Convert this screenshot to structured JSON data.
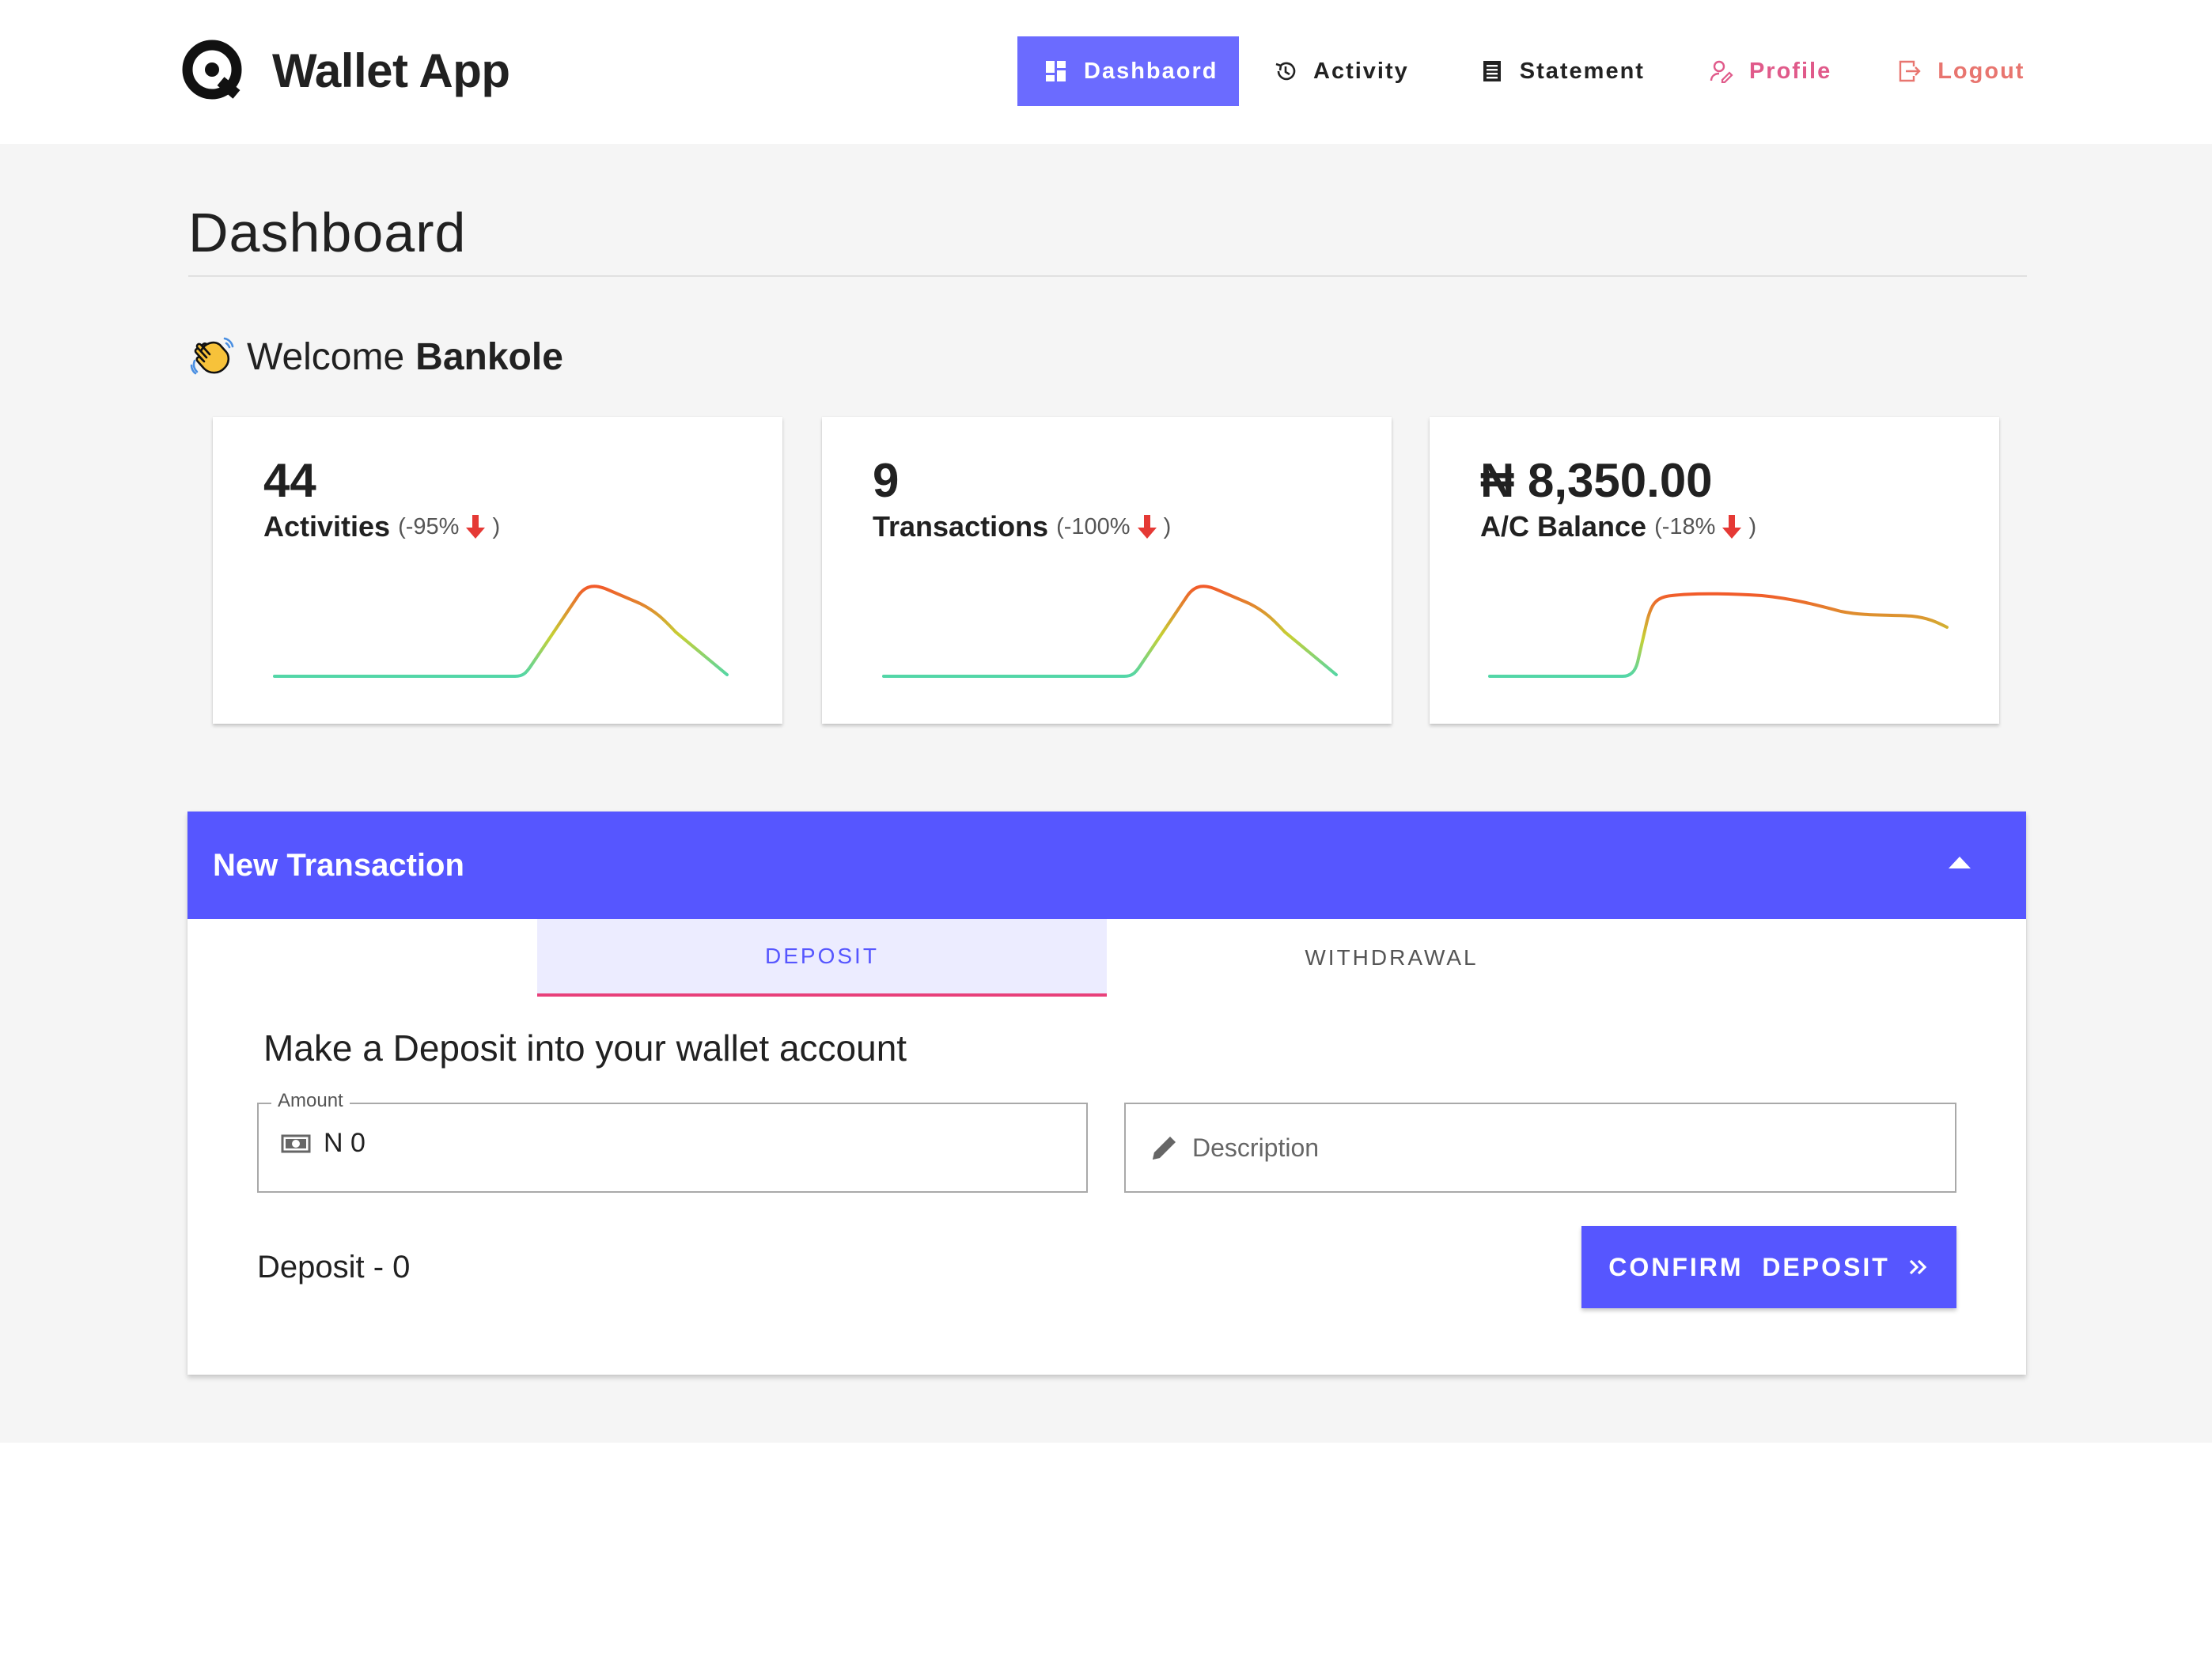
{
  "header": {
    "app_title": "Wallet App",
    "logo_icon": "q-logo-icon",
    "nav": {
      "dashboard": "Dashbaord",
      "activity": "Activity",
      "statement": "Statement",
      "profile": "Profile",
      "logout": "Logout"
    },
    "active_item": "dashboard",
    "colors": {
      "active_bg": "#6b6bff",
      "profile": "#e05a8a",
      "logout": "#e8756f"
    }
  },
  "page": {
    "title": "Dashboard",
    "welcome_prefix": "Welcome",
    "user_name": "Bankole",
    "welcome_icon": "waving-hand-icon"
  },
  "cards": [
    {
      "value": "44",
      "label": "Activities",
      "change_open": "(-95%",
      "change_close": ")",
      "trend_icon": "arrow-down-icon"
    },
    {
      "value": "9",
      "label": "Transactions",
      "change_open": "(-100%",
      "change_close": ")",
      "trend_icon": "arrow-down-icon"
    },
    {
      "value": "₦ 8,350.00",
      "label": "A/C Balance",
      "change_open": "(-18%",
      "change_close": ")",
      "trend_icon": "arrow-down-icon"
    }
  ],
  "new_transaction": {
    "title": "New Transaction",
    "toggle_icon": "caret-up-icon",
    "tabs": [
      "DEPOSIT",
      "WITHDRAWAL"
    ],
    "active_tab": "DEPOSIT",
    "heading": "Make a Deposit into your wallet account",
    "amount": {
      "label": "Amount",
      "value": "N 0",
      "icon": "money-icon"
    },
    "description": {
      "placeholder": "Description",
      "icon": "pencil-icon"
    },
    "deposit_total": "Deposit - 0",
    "confirm_label": "CONFIRM  DEPOSIT",
    "confirm_icon": "double-chevron-right-icon",
    "colors": {
      "header_bg": "#5656ff",
      "tab_underline": "#e8407a",
      "tab_bg": "#ececff"
    }
  }
}
